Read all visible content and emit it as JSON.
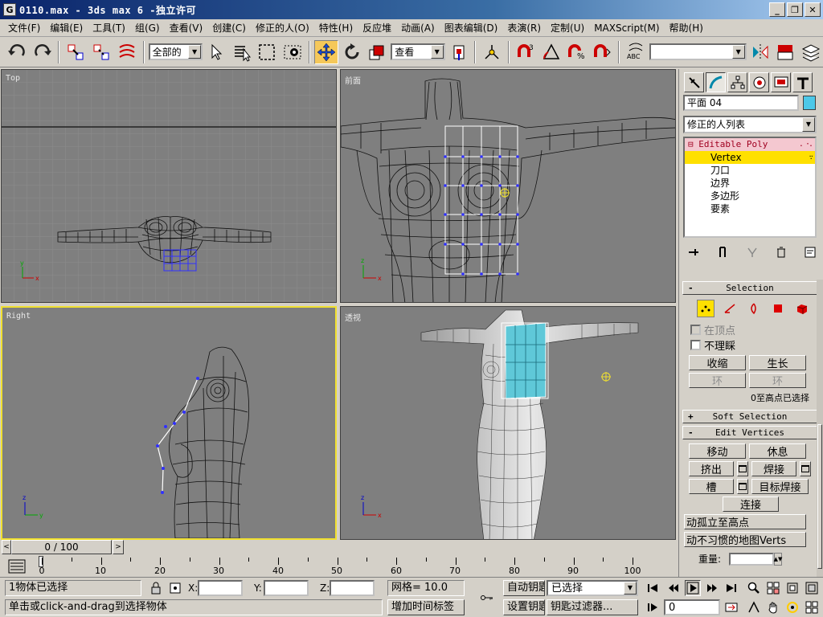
{
  "window": {
    "icon_letter": "G",
    "title": "0110.max - 3ds max 6 -独立许可",
    "buttons": [
      "_",
      "❐",
      "✕"
    ]
  },
  "menu": [
    "文件(F)",
    "编辑(E)",
    "工具(T)",
    "组(G)",
    "查看(V)",
    "创建(C)",
    "修正的人(O)",
    "特性(H)",
    "反应堆",
    "动画(A)",
    "图表编辑(D)",
    "表演(R)",
    "定制(U)",
    "MAXScript(M)",
    "帮助(H)"
  ],
  "toolbar": {
    "selection_filter": "全部的",
    "reference_coord": "查看",
    "named_selection": ""
  },
  "viewports": {
    "top": {
      "label": "Top"
    },
    "front": {
      "label": "前面"
    },
    "right": {
      "label": "Right"
    },
    "perspective": {
      "label": "透视"
    }
  },
  "command_panel": {
    "object_name": "平面 04",
    "object_color": "#4dc8e8",
    "modifier_list": "修正的人列表",
    "stack": {
      "base": "Editable Poly",
      "levels": [
        "Vertex",
        "刀口",
        "边界",
        "多边形",
        "要素"
      ],
      "active_level": "Vertex"
    },
    "selection": {
      "title": "Selection",
      "by_vertex": "在顶点",
      "ignore_backfacing": "不理睬",
      "shrink": "收缩",
      "grow": "生长",
      "ring": "环",
      "loop": "环",
      "info": "0至高点已选择"
    },
    "soft_selection": {
      "title": "Soft Selection"
    },
    "edit_vertices": {
      "title": "Edit Vertices",
      "move": "移动",
      "rest": "休息",
      "extrude": "挤出",
      "weld": "焊接",
      "chamfer": "槽",
      "target_weld": "目标焊接",
      "connect": "连接",
      "remove_isolated": "动孤立至高点",
      "remove_unused_map": "动不习惯的地图Verts",
      "weight_label": "重量:"
    }
  },
  "timeline": {
    "frame_display": "0 / 100",
    "ticks": [
      "0",
      "10",
      "20",
      "30",
      "40",
      "50",
      "60",
      "70",
      "80",
      "90",
      "100"
    ]
  },
  "status": {
    "selection_count": "1物体已选择",
    "prompt": "单击或click-and-drag到选择物体",
    "x_label": "X:",
    "y_label": "Y:",
    "z_label": "Z:",
    "x_value": "",
    "y_value": "",
    "z_value": "",
    "grid": "网格= 10.0",
    "add_time_tag": "增加时间标签",
    "auto_key": "自动钥匙",
    "set_key": "设置钥匙",
    "key_mode": "已选择",
    "key_filters": "钥匙过滤器...",
    "current_frame": "0"
  }
}
